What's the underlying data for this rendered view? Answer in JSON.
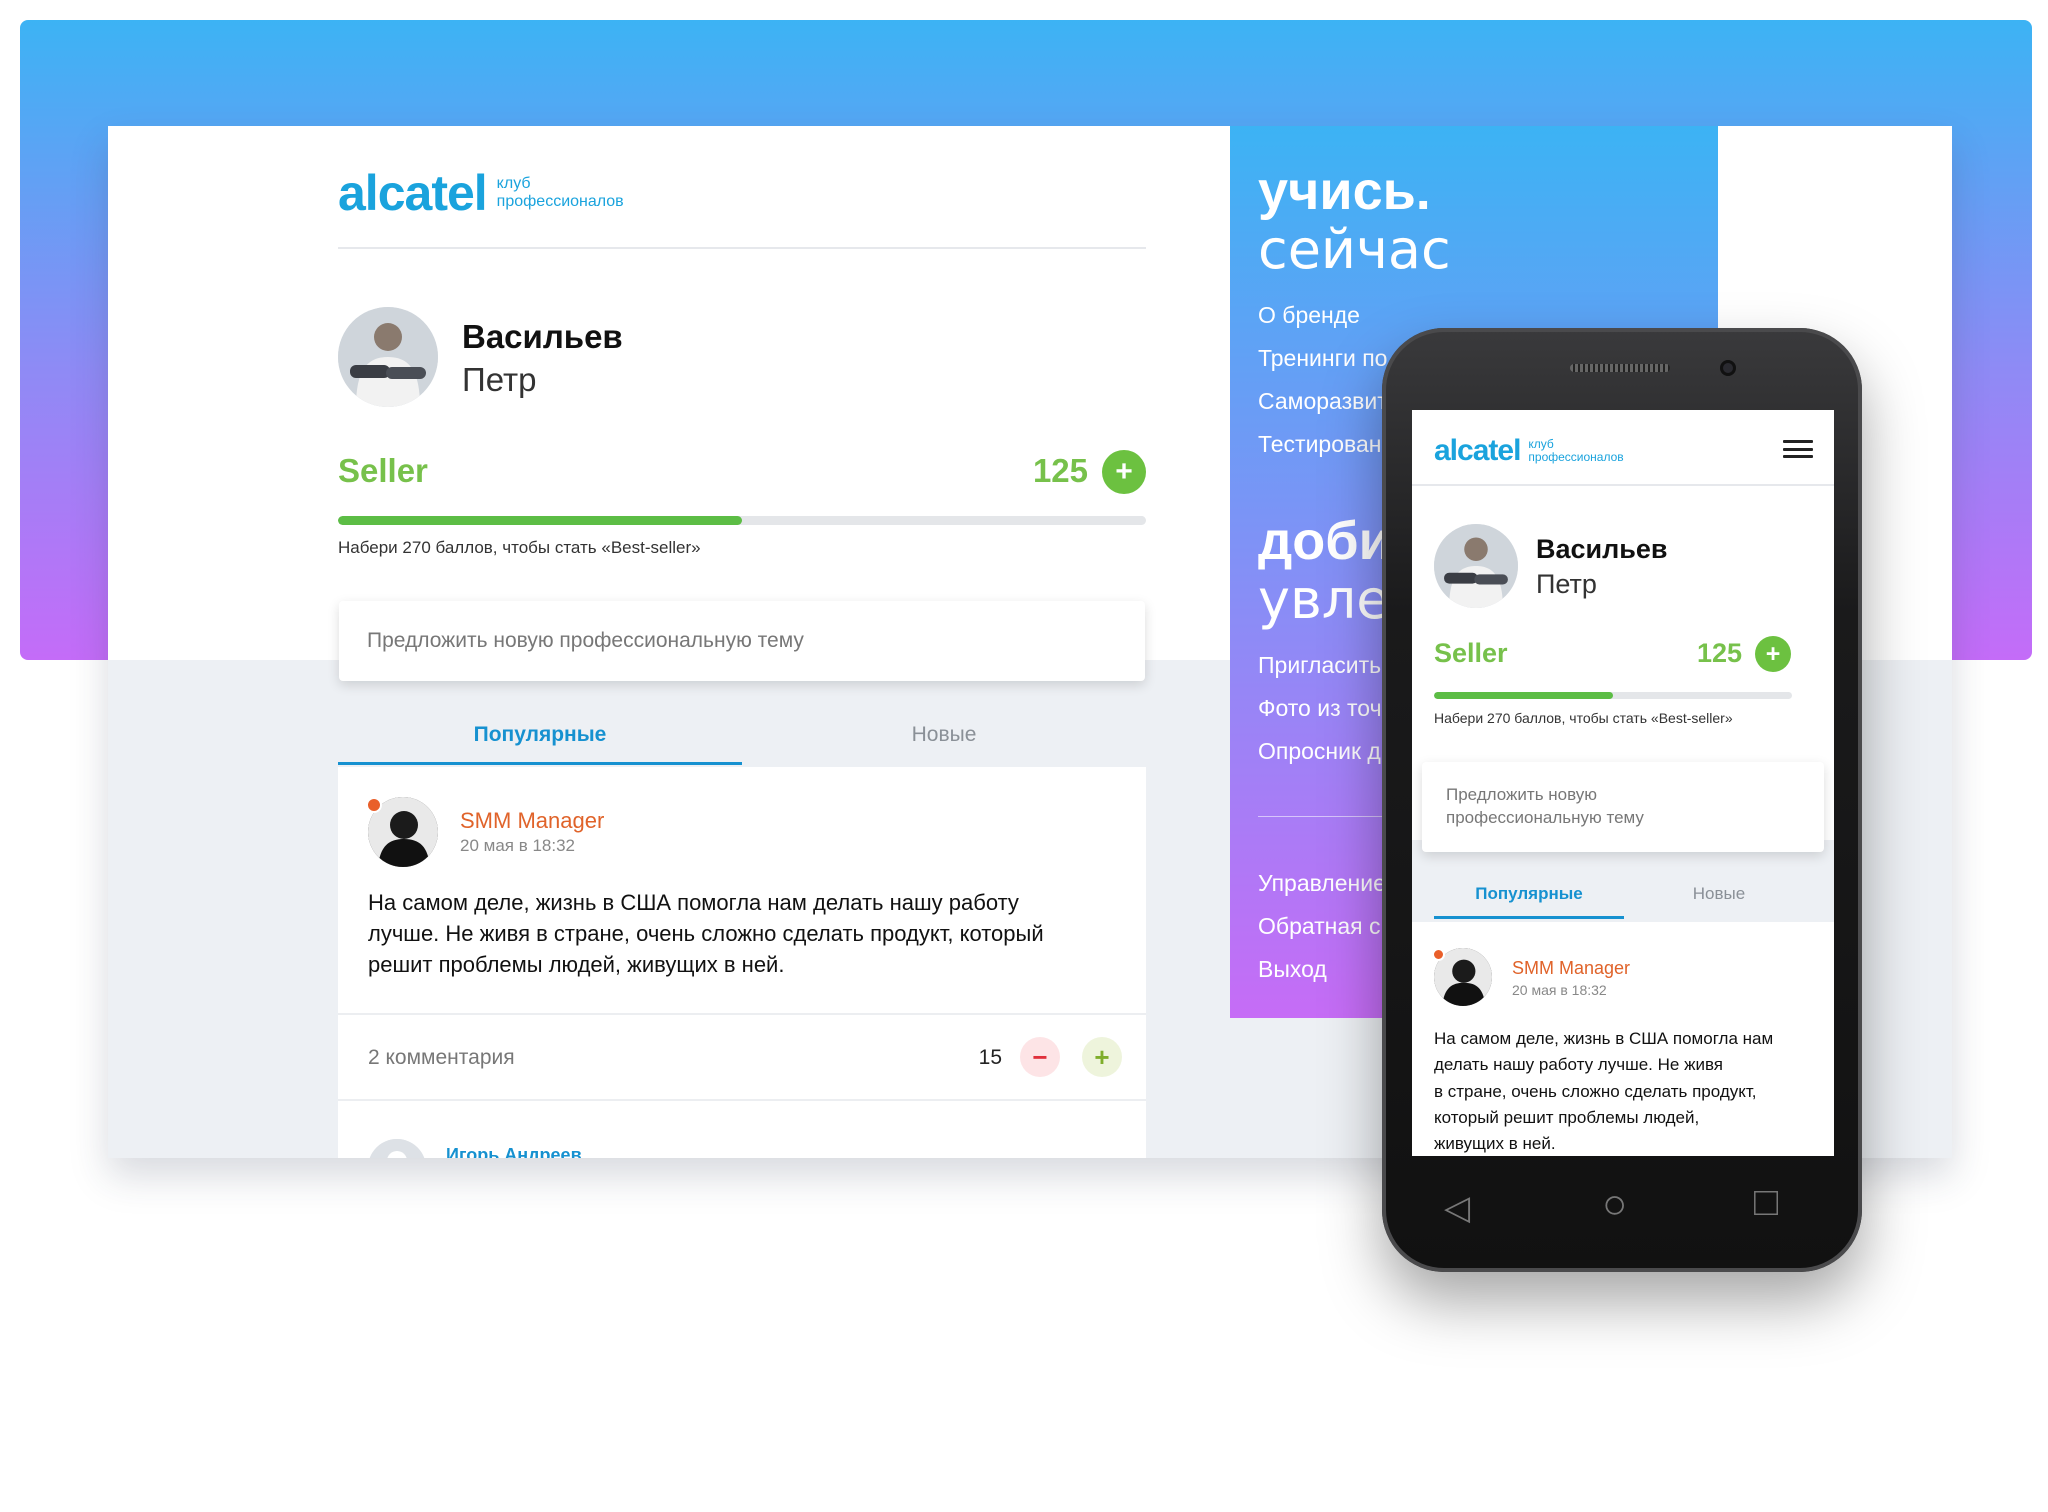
{
  "brand": {
    "wordmark": "alcatel",
    "tagline_line1": "клуб",
    "tagline_line2": "профессионалов"
  },
  "profile": {
    "surname": "Васильев",
    "firstname": "Петр",
    "level": "Seller",
    "score": "125",
    "progress": 0.5,
    "hint": "Набери 270 баллов, чтобы стать «Best-seller»",
    "plus_label": "+"
  },
  "suggest": {
    "desktop_placeholder": "Предложить новую профессиональную тему",
    "mobile_line1": "Предложить новую",
    "mobile_line2": "профессиональную тему"
  },
  "tabs": [
    {
      "label": "Популярные",
      "active": true
    },
    {
      "label": "Новые",
      "active": false
    }
  ],
  "post": {
    "author": "SMM Manager",
    "date": "20 мая в 18:32",
    "text_desktop": [
      "На самом деле, жизнь в США помогла нам делать нашу работу",
      "лучше. Не живя в стране, очень сложно сделать продукт, который",
      "решит проблемы людей, живущих в ней."
    ],
    "text_mobile": [
      "На самом деле, жизнь в США помогла нам",
      "делать нашу работу лучше. Не живя",
      "в стране, очень сложно сделать продукт,",
      "который решит проблемы людей,",
      "живущих в ней."
    ],
    "comments": "2 комментария",
    "votes": "15",
    "vote_minus": "−",
    "vote_plus": "+"
  },
  "reply": {
    "author": "Игорь Андреев"
  },
  "side_menu": {
    "headline1_strong": "учись.",
    "headline1_light": "сейчас",
    "section1": [
      "О бренде",
      "Тренинги по",
      "Саморазвит",
      "Тестирован"
    ],
    "headline2_strong": "доби",
    "headline2_light": "увлеч",
    "section2": [
      "Пригласить",
      "Фото из точ",
      "Опросник д"
    ],
    "section3": [
      "Управление",
      "Обратная св",
      "Выход"
    ]
  },
  "phone_nav": {
    "back": "◁",
    "home": "○",
    "recent": "□"
  },
  "colors": {
    "accent_blue": "#1691d0",
    "brand_blue": "#1aa3dd",
    "level_green": "#77c14b",
    "author_orange": "#e0632a",
    "gradient_top": "#3cb3f4",
    "gradient_bottom": "#c46cf8"
  }
}
